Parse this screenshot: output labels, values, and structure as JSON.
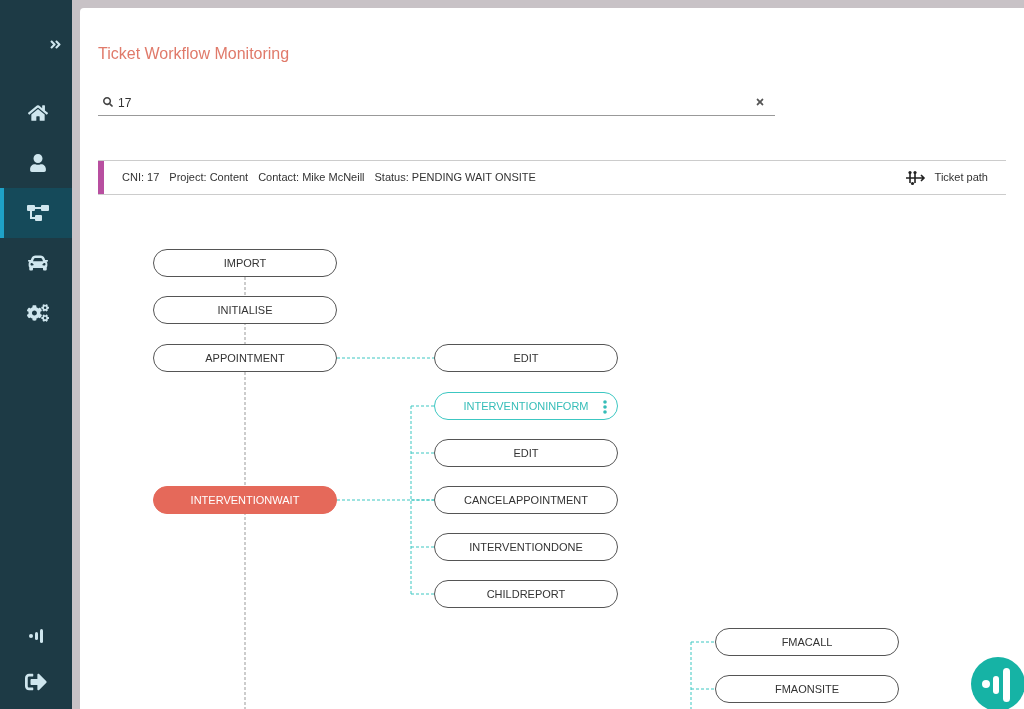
{
  "sidebar": {
    "items": [
      {
        "selected": false
      },
      {
        "selected": false
      },
      {
        "selected": true
      },
      {
        "selected": false
      },
      {
        "selected": false
      }
    ]
  },
  "page": {
    "title": "Ticket Workflow Monitoring"
  },
  "search": {
    "value": "17"
  },
  "ticket_bar": {
    "fields": [
      "CNI: 17",
      "Project: Content",
      "Contact: Mike McNeill",
      "Status: PENDING WAIT ONSITE"
    ],
    "action": "Ticket path"
  },
  "workflow": {
    "steps": [
      {
        "label": "IMPORT",
        "kind": "default"
      },
      {
        "label": "INITIALISE",
        "kind": "default"
      },
      {
        "label": "APPOINTMENT",
        "kind": "default",
        "children": [
          {
            "label": "EDIT",
            "kind": "default"
          }
        ]
      },
      {
        "label": "INTERVENTIONWAIT",
        "kind": "current",
        "children": [
          {
            "label": "INTERVENTIONINFORM",
            "kind": "focused"
          },
          {
            "label": "EDIT",
            "kind": "default"
          },
          {
            "label": "CANCELAPPOINTMENT",
            "kind": "default"
          },
          {
            "label": "INTERVENTIONDONE",
            "kind": "default"
          },
          {
            "label": "CHILDREPORT",
            "kind": "default"
          }
        ]
      }
    ],
    "lower_branch": [
      {
        "label": "FMACALL",
        "kind": "default"
      },
      {
        "label": "FMAONSITE",
        "kind": "default"
      }
    ]
  }
}
